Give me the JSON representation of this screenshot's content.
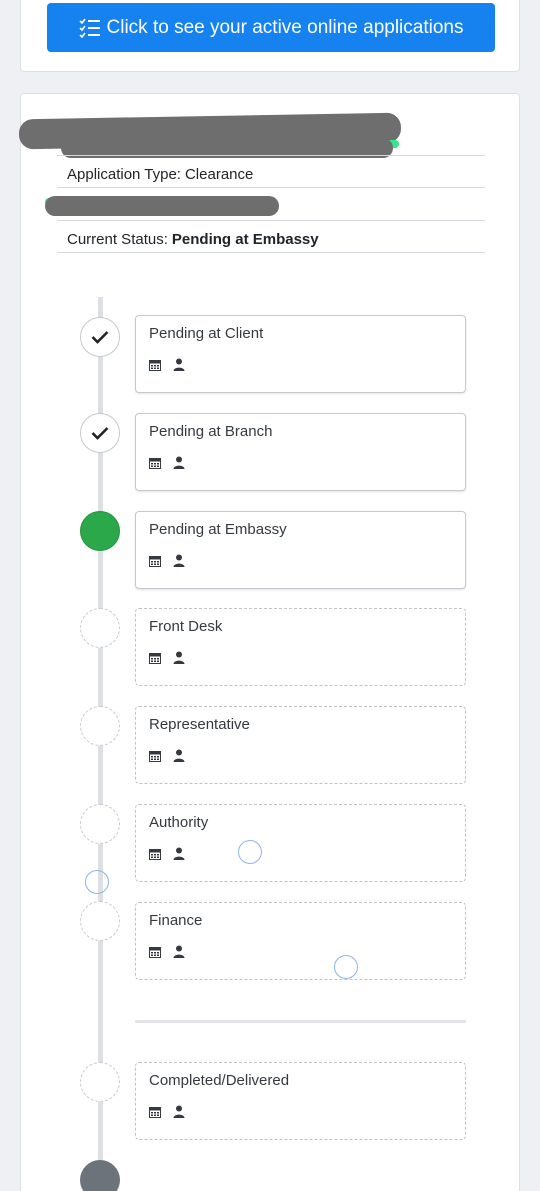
{
  "header": {
    "button_label": "Click to see your active online applications",
    "button_icon": "list-check-icon"
  },
  "application": {
    "type_label": "Application Type:",
    "type_value": "Clearance",
    "status_label": "Current Status:",
    "status_value": "Pending at Embassy"
  },
  "timeline": {
    "steps": [
      {
        "title": "Pending at Client",
        "state": "done"
      },
      {
        "title": "Pending at Branch",
        "state": "done"
      },
      {
        "title": "Pending at Embassy",
        "state": "current"
      },
      {
        "title": "Front Desk",
        "state": "pending"
      },
      {
        "title": "Representative",
        "state": "pending"
      },
      {
        "title": "Authority",
        "state": "pending"
      },
      {
        "title": "Finance",
        "state": "pending"
      },
      {
        "title": "Completed/Delivered",
        "state": "pending"
      }
    ],
    "step_icons": [
      "calendar-icon",
      "user-icon"
    ]
  },
  "colors": {
    "primary": "#1582f0",
    "success": "#2aa84a",
    "final_node": "#6c737b"
  }
}
